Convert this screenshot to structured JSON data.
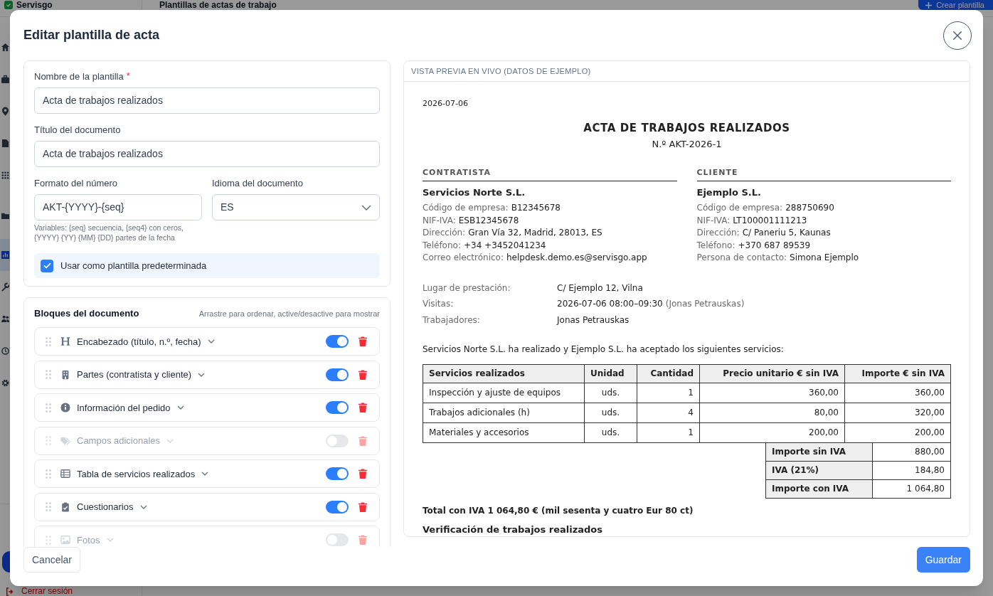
{
  "background": {
    "app_name": "Servisgo",
    "page_title": "Plantillas de actas de trabajo",
    "create_button": {
      "label": "Crear plantilla"
    },
    "sidebar": {
      "items": [
        {
          "selected": false
        },
        {
          "selected": false
        },
        {
          "selected": false
        },
        {
          "selected": false
        },
        {
          "selected": false
        },
        {
          "selected": false
        },
        {
          "selected": true
        },
        {
          "selected": false
        },
        {
          "selected": false
        },
        {
          "selected": false
        },
        {
          "selected": false
        }
      ]
    },
    "logout": "Cerrar sesión"
  },
  "dialog": {
    "title": "Editar plantilla de acta",
    "settings": {
      "name_field": {
        "label": "Nombre de la plantilla",
        "required_mark": "*",
        "value": "Acta de trabajos realizados"
      },
      "title_field": {
        "label": "Título del documento",
        "value": "Acta de trabajos realizados"
      },
      "number_format": {
        "label": "Formato del número",
        "value": "AKT-{YYYY}-{seq}",
        "hint": "Variables: {seq} secuencia, {seq4} con ceros, {YYYY} {YY} {MM} {DD} partes de la fecha"
      },
      "language": {
        "label": "Idioma del documento",
        "value": "ES"
      },
      "default_checkbox": {
        "label": "Usar como plantilla predeterminada",
        "checked": true
      }
    },
    "blocks": {
      "title": "Bloques del documento",
      "hint": "Arrastre para ordenar, active/desactive para mostrar",
      "items": [
        {
          "label": "Encabezado (título, n.º, fecha)",
          "enabled": true
        },
        {
          "label": "Partes (contratista y cliente)",
          "enabled": true
        },
        {
          "label": "Información del pedido",
          "enabled": true
        },
        {
          "label": "Campos adicionales",
          "enabled": false
        },
        {
          "label": "Tabla de servicios realizados",
          "enabled": true
        },
        {
          "label": "Cuestionarios",
          "enabled": true
        },
        {
          "label": "Fotos",
          "enabled": false
        }
      ]
    },
    "preview": {
      "header": "VISTA PREVIA EN VIVO (DATOS DE EJEMPLO)",
      "document": {
        "date": "2026-07-06",
        "title": "ACTA DE TRABAJOS REALIZADOS",
        "number": "N.º AKT-2026-1",
        "parties": [
          {
            "heading": "CONTRATISTA",
            "name": "Servicios Norte S.L.",
            "fields": [
              {
                "label": "Código de empresa:",
                "value": "B12345678"
              },
              {
                "label": "NIF-IVA:",
                "value": "ESB12345678"
              },
              {
                "label": "Dirección:",
                "value": "Gran Vía 32, Madrid, 28013, ES"
              },
              {
                "label": "Teléfono:",
                "value": "+34 +3452041234"
              },
              {
                "label": "Correo electrónico:",
                "value": "helpdesk.demo.es@servisgo.app"
              }
            ]
          },
          {
            "heading": "CLIENTE",
            "name": "Ejemplo S.L.",
            "fields": [
              {
                "label": "Código de empresa:",
                "value": "288750690"
              },
              {
                "label": "NIF-IVA:",
                "value": "LT100001111213"
              },
              {
                "label": "Dirección:",
                "value": "C/ Paneriu 5, Kaunas"
              },
              {
                "label": "Teléfono:",
                "value": "+370 687 89539"
              },
              {
                "label": "Persona de contacto:",
                "value": "Simona Ejemplo"
              }
            ]
          }
        ],
        "info": [
          {
            "label": "Lugar de prestación:",
            "value": "C/ Ejemplo 12, Vilna"
          },
          {
            "label": "Visitas:",
            "value": "2026-07-06 08:00–09:30",
            "note": "(Jonas Petrauskas)"
          },
          {
            "label": "Trabajadores:",
            "value": "Jonas Petrauskas"
          }
        ],
        "intro": "Servicios Norte S.L. ha realizado y Ejemplo S.L. ha aceptado los siguientes servicios:",
        "services_table": {
          "columns": [
            "Servicios realizados",
            "Unidad",
            "Cantidad",
            "Precio unitario € sin IVA",
            "Importe € sin IVA"
          ],
          "rows": [
            [
              "Inspección y ajuste de equipos",
              "uds.",
              "1",
              "360,00",
              "360,00"
            ],
            [
              "Trabajos adicionales (h)",
              "uds.",
              "4",
              "80,00",
              "320,00"
            ],
            [
              "Materiales y accesorios",
              "uds.",
              "1",
              "200,00",
              "200,00"
            ]
          ]
        },
        "totals": [
          {
            "label": "Importe sin IVA",
            "value": "880,00"
          },
          {
            "label": "IVA (21%)",
            "value": "184,80"
          },
          {
            "label": "Importe con IVA",
            "value": "1 064,80"
          }
        ],
        "total_line": "Total con IVA 1 064,80 € (mil sesenta y cuatro Eur 80 ct)",
        "next_section": "Verificación de trabajos realizados"
      }
    },
    "buttons": {
      "cancel": "Cancelar",
      "save": "Guardar"
    }
  }
}
